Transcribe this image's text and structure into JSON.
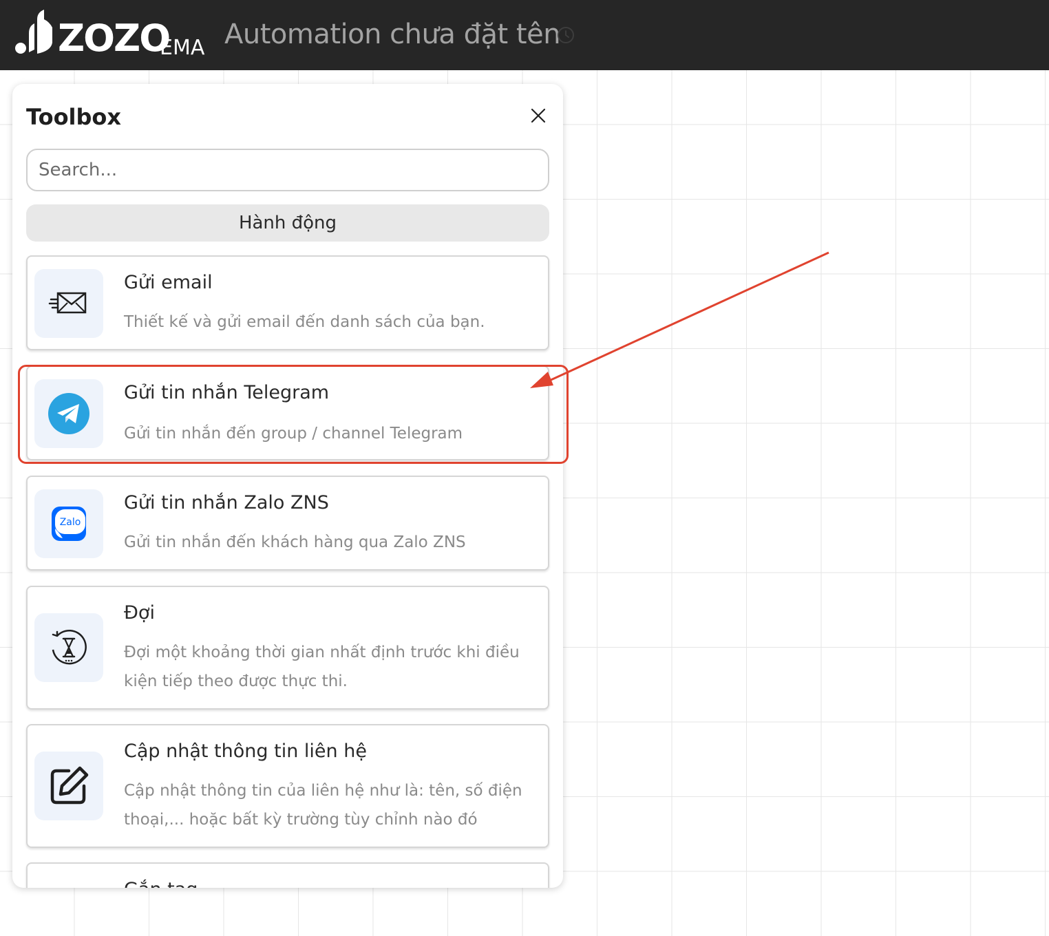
{
  "header": {
    "logo_text": "ZOZO",
    "logo_sub": "EMA",
    "title": "Automation chưa đặt tên",
    "history_icon": "history-icon"
  },
  "toolbox": {
    "title": "Toolbox",
    "search_placeholder": "Search...",
    "category": "Hành động",
    "items": [
      {
        "title": "Gửi email",
        "desc": "Thiết kế và gửi email đến danh sách của bạn.",
        "icon": "send-email-icon"
      },
      {
        "title": "Gửi tin nhắn Telegram",
        "desc": "Gửi tin nhắn đến group / channel Telegram",
        "icon": "telegram-icon"
      },
      {
        "title": "Gửi tin nhắn Zalo ZNS",
        "desc": "Gửi tin nhắn đến khách hàng qua Zalo ZNS",
        "icon": "zalo-icon",
        "icon_label": "Zalo"
      },
      {
        "title": "Đợi",
        "desc": "Đợi một khoảng thời gian nhất định trước khi điều kiện tiếp theo được thực thi.",
        "icon": "hourglass-timer-icon"
      },
      {
        "title": "Cập nhật thông tin liên hệ",
        "desc": "Cập nhật thông tin của liên hệ như là: tên, số điện thoại,... hoặc bất kỳ trường tùy chỉnh nào đó",
        "icon": "edit-icon"
      },
      {
        "title": "Gắn tag",
        "icon": "tag-icon"
      }
    ]
  },
  "colors": {
    "topbar": "#262626",
    "annotation": "#e0432f",
    "telegram": "#2aa3e0",
    "zalo": "#0068ff"
  }
}
